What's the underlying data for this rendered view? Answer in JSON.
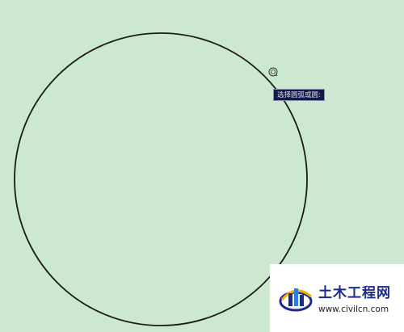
{
  "tooltip": {
    "text": "选择圆弧或圆:"
  },
  "watermark": {
    "title": "土木工程网",
    "url": "www.civilcn.com"
  },
  "colors": {
    "background": "#cce8d0",
    "tooltip_background": "#15184a",
    "circle_stroke": "#1e1a1a",
    "brand_blue": "#1b2a8c",
    "brand_yellow": "#f0b400"
  },
  "icons": {
    "cursor": "pickbox-cursor-icon",
    "logo": "civilcn-logo-icon"
  }
}
